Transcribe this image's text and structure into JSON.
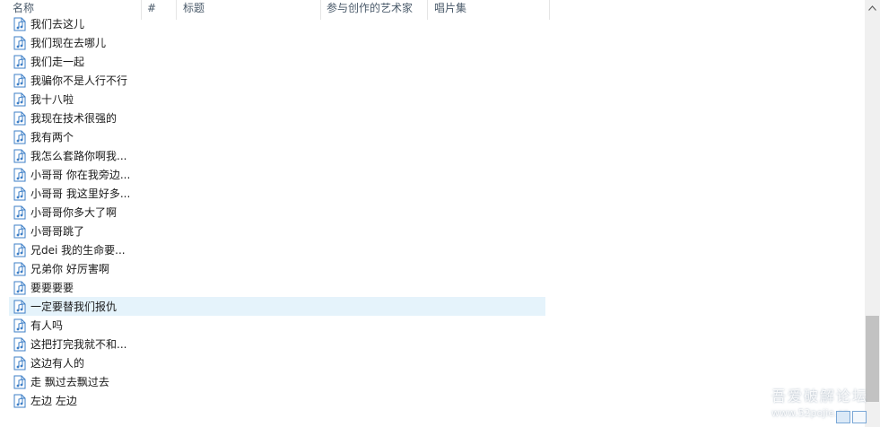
{
  "columns": {
    "name": "名称",
    "number": "#",
    "title": "标题",
    "artist": "参与创作的艺术家",
    "album": "唱片集"
  },
  "files": [
    {
      "name": "我们去这儿"
    },
    {
      "name": "我们现在去哪儿"
    },
    {
      "name": "我们走一起"
    },
    {
      "name": "我骗你不是人行不行"
    },
    {
      "name": "我十八啦"
    },
    {
      "name": "我现在技术很强的"
    },
    {
      "name": "我有两个"
    },
    {
      "name": "我怎么套路你啊我..."
    },
    {
      "name": "小哥哥 你在我旁边..."
    },
    {
      "name": "小哥哥 我这里好多..."
    },
    {
      "name": "小哥哥你多大了啊"
    },
    {
      "name": "小哥哥跳了"
    },
    {
      "name": "兄dei 我的生命要..."
    },
    {
      "name": "兄弟你 好厉害啊"
    },
    {
      "name": "要要要要"
    },
    {
      "name": "一定要替我们报仇",
      "selected": true
    },
    {
      "name": "有人吗"
    },
    {
      "name": "这把打完我就不和..."
    },
    {
      "name": "这边有人的"
    },
    {
      "name": "走 飘过去飘过去"
    },
    {
      "name": "左边 左边"
    }
  ],
  "watermark": {
    "line1": "吾爱破解论坛",
    "line2": "www.52pojie.cn"
  },
  "icons": {
    "file": "music-file-icon",
    "scroll_up": "chevron-up-icon",
    "view_details": "details-view-icon",
    "view_large": "large-icons-view-icon"
  },
  "colors": {
    "selected_row": "#e5f3fb",
    "icon_stroke": "#3d7fc7",
    "header_text": "#4a5a6a"
  }
}
